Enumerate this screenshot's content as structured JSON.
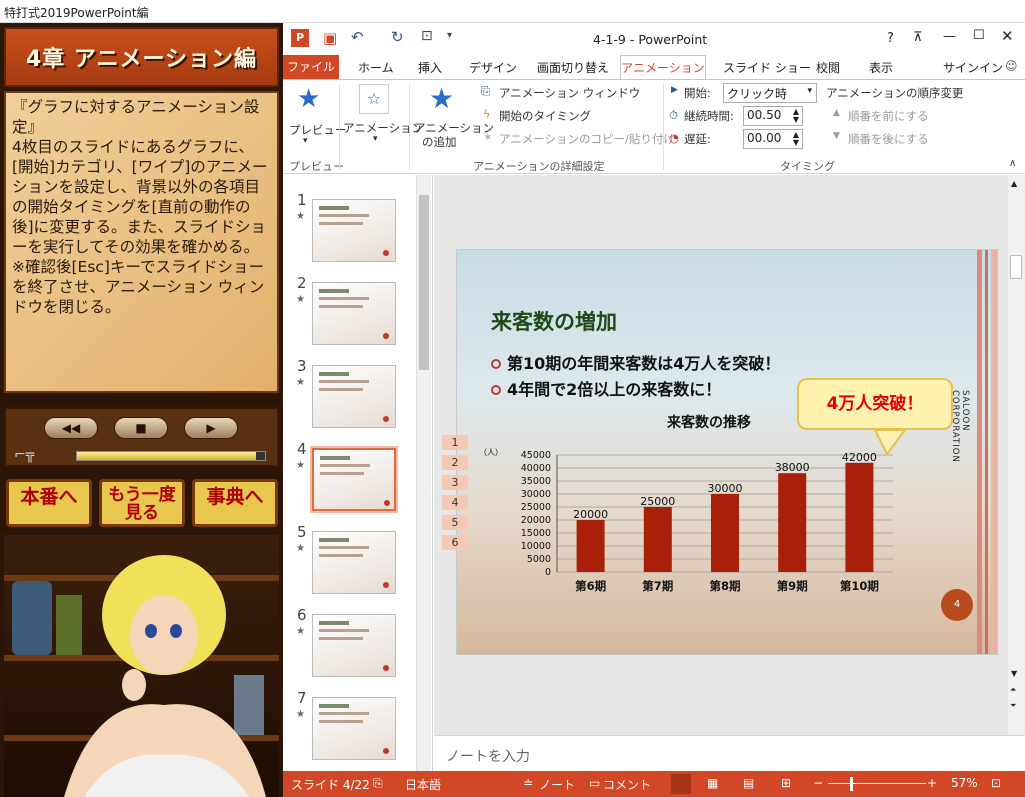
{
  "outer_title": "特打式2019PowerPoint編",
  "left_panel": {
    "chapter": "4章 アニメーション編",
    "instruction": "『グラフに対するアニメーション設定』\n4枚目のスライドにあるグラフに、[開始]カテゴリ、[ワイプ]のアニメーションを設定し、背景以外の各項目の開始タイミングを[直前の動作の後]に変更する。また、スライドショーを実行してその効果を確かめる。\n※確認後[Esc]キーでスライドショーを終了させ、アニメーション ウィンドウを閉じる。",
    "nav_buttons": [
      "本番へ",
      "もう一度見る",
      "事典へ"
    ],
    "gauge_level": 0.95
  },
  "window": {
    "title": "4-1-9 - PowerPoint",
    "help": "?",
    "signin": "サインイン"
  },
  "tabs": [
    "ファイル",
    "ホーム",
    "挿入",
    "デザイン",
    "画面切り替え",
    "アニメーション",
    "スライド ショー",
    "校閲",
    "表示"
  ],
  "ribbon": {
    "preview": "プレビュー",
    "preview_group": "プレビュー",
    "animation": "アニメーション",
    "add_animation_1": "アニメーション",
    "add_animation_2": "の追加",
    "anim_window": "アニメーション ウィンドウ",
    "start_timing": "開始のタイミング",
    "copy_paste": "アニメーションのコピー/貼り付け",
    "detail_group": "アニメーションの詳細設定",
    "start_label": "開始:",
    "start_value": "クリック時",
    "duration_label": "継続時間:",
    "duration_value": "00.50",
    "delay_label": "遅延:",
    "delay_value": "00.00",
    "timing_group": "タイミング",
    "reorder_title": "アニメーションの順序変更",
    "move_earlier": "順番を前にする",
    "move_later": "順番を後にする"
  },
  "thumbnails": [
    {
      "num": "1",
      "star": "★"
    },
    {
      "num": "2",
      "star": "★"
    },
    {
      "num": "3",
      "star": "★"
    },
    {
      "num": "4",
      "star": "★"
    },
    {
      "num": "5",
      "star": "★"
    },
    {
      "num": "6",
      "star": "★"
    },
    {
      "num": "7",
      "star": "★"
    }
  ],
  "slide": {
    "title": "来客数の増加",
    "bullet1": "第10期の年間来客数は4万人を突破！",
    "bullet2": "4年間で2倍以上の来客数に！",
    "callout": "4万人突破！",
    "corp": "SALOON CORPORATION",
    "number": "4",
    "anim_tags": [
      "1",
      "2",
      "3",
      "4",
      "5",
      "6"
    ]
  },
  "chart_data": {
    "type": "bar",
    "title": "来客数の推移",
    "ylabel": "（人）",
    "categories": [
      "第6期",
      "第7期",
      "第8期",
      "第9期",
      "第10期"
    ],
    "values": [
      20000,
      25000,
      30000,
      38000,
      42000
    ],
    "ylim": [
      0,
      45000
    ],
    "ytick_step": 5000,
    "color": "#a8200a"
  },
  "notes": "ノートを入力",
  "status": {
    "slide": "スライド 4/22",
    "lang": "日本語",
    "notes": "ノート",
    "comments": "コメント",
    "zoom": "57%"
  }
}
